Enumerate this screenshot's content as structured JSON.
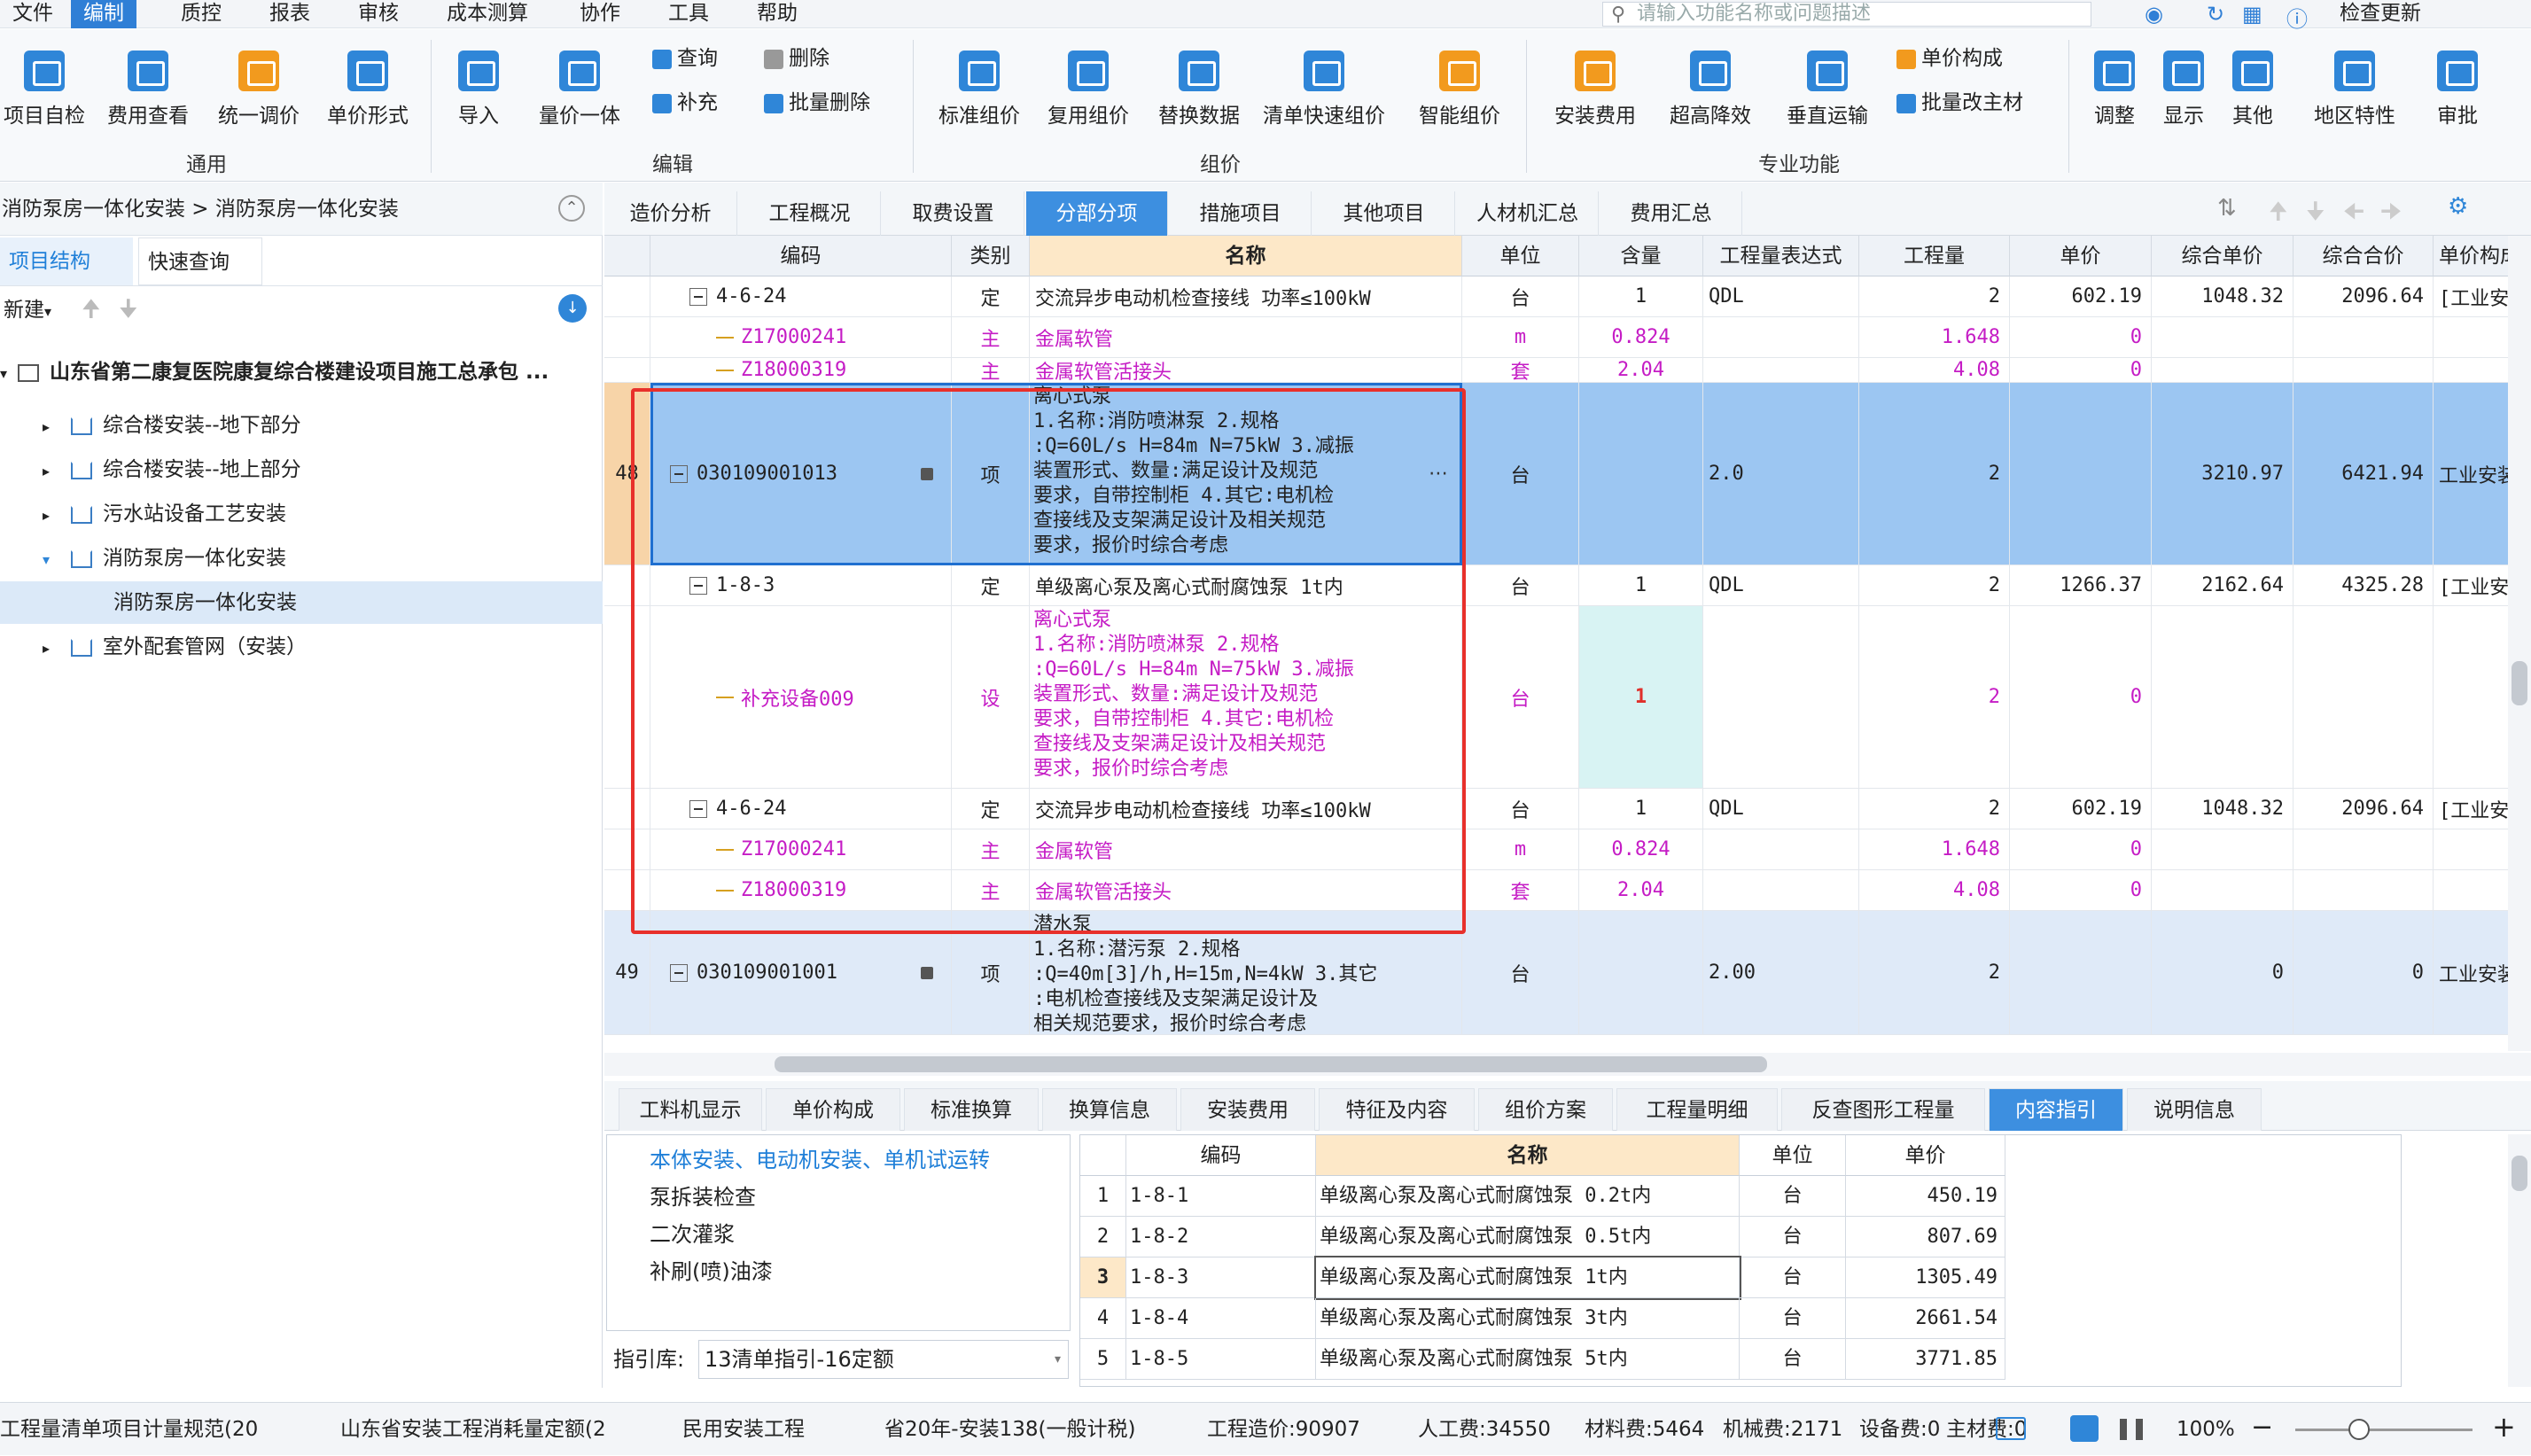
{
  "menubar": {
    "items": [
      "文件",
      "编制",
      "质控",
      "报表",
      "审核",
      "成本测算",
      "协作",
      "工具",
      "帮助"
    ],
    "search_placeholder": "请输入功能名称或问题描述",
    "check_update": "检查更新"
  },
  "ribbon": {
    "general": {
      "label": "通用",
      "buttons": [
        "项目自检",
        "费用查看",
        "统一调价",
        "单价形式"
      ]
    },
    "edit": {
      "label": "编辑",
      "buttons": [
        "导入",
        "量价一体"
      ],
      "small": [
        "查询",
        "删除",
        "补充",
        "批量删除"
      ]
    },
    "group": {
      "label": "组价",
      "buttons": [
        "标准组价",
        "复用组价",
        "替换数据",
        "清单快速组价",
        "智能组价"
      ]
    },
    "special": {
      "label": "专业功能",
      "buttons": [
        "安装费用",
        "超高降效",
        "垂直运输"
      ],
      "small": [
        "单价构成",
        "批量改主材"
      ]
    },
    "right": {
      "buttons": [
        "调整",
        "显示",
        "其他",
        "地区特性",
        "审批"
      ]
    }
  },
  "left": {
    "breadcrumb": "消防泵房一体化安装 > 消防泵房一体化安装",
    "tabs": [
      "项目结构",
      "快速查询"
    ],
    "new_label": "新建",
    "root": "山东省第二康复医院康复综合楼建设项目施工总承包 ...",
    "nodes": [
      "综合楼安装--地下部分",
      "综合楼安装--地上部分",
      "污水站设备工艺安装",
      "消防泵房一体化安装",
      "消防泵房一体化安装",
      "室外配套管网（安装）"
    ]
  },
  "main_tabs": [
    "造价分析",
    "工程概况",
    "取费设置",
    "分部分项",
    "措施项目",
    "其他项目",
    "人材机汇总",
    "费用汇总"
  ],
  "grid": {
    "headers": [
      "编码",
      "类别",
      "名称",
      "单位",
      "含量",
      "工程量表达式",
      "工程量",
      "单价",
      "综合单价",
      "综合合价",
      "单价构成"
    ],
    "rows": [
      {
        "no": "",
        "code": "4-6-24",
        "type": "定",
        "name": "交流异步电动机检查接线 功率≤100kW",
        "unit": "台",
        "qty_ratio": "1",
        "expr": "QDL",
        "qty": "2",
        "price": "602.19",
        "comp_price": "1048.32",
        "comp_total": "2096.64",
        "struct": "[工业安装"
      },
      {
        "no": "",
        "code": "Z17000241",
        "type": "主",
        "name": "金属软管",
        "unit": "m",
        "qty_ratio": "0.824",
        "expr": "",
        "qty": "1.648",
        "price": "0",
        "comp_price": "",
        "comp_total": "",
        "struct": ""
      },
      {
        "no": "",
        "code": "Z18000319",
        "type": "主",
        "name": "金属软管活接头",
        "unit": "套",
        "qty_ratio": "2.04",
        "expr": "",
        "qty": "4.08",
        "price": "0",
        "comp_price": "",
        "comp_total": "",
        "struct": ""
      },
      {
        "no": "48",
        "code": "030109001013",
        "type": "项",
        "name": "离心式泵\n1.名称:消防喷淋泵 2.规格\n:Q=60L/s  H=84m  N=75kW  3.减振\n装置形式、数量:满足设计及规范\n要求，自带控制柜 4.其它:电机检\n查接线及支架满足设计及相关规范\n要求，报价时综合考虑",
        "unit": "台",
        "qty_ratio": "",
        "expr": "2.0",
        "qty": "2",
        "price": "",
        "comp_price": "3210.97",
        "comp_total": "6421.94",
        "struct": "工业安装工"
      },
      {
        "no": "",
        "code": "1-8-3",
        "type": "定",
        "name": "单级离心泵及离心式耐腐蚀泵 1t内",
        "unit": "台",
        "qty_ratio": "1",
        "expr": "QDL",
        "qty": "2",
        "price": "1266.37",
        "comp_price": "2162.64",
        "comp_total": "4325.28",
        "struct": "[工业安装"
      },
      {
        "no": "",
        "code": "补充设备009",
        "type": "设",
        "name": "离心式泵\n1.名称:消防喷淋泵 2.规格\n:Q=60L/s  H=84m  N=75kW  3.减振\n装置形式、数量:满足设计及规范\n要求，自带控制柜 4.其它:电机检\n查接线及支架满足设计及相关规范\n要求，报价时综合考虑",
        "unit": "台",
        "qty_ratio": "1",
        "expr": "",
        "qty": "2",
        "price": "0",
        "comp_price": "",
        "comp_total": "",
        "struct": ""
      },
      {
        "no": "",
        "code": "4-6-24",
        "type": "定",
        "name": "交流异步电动机检查接线 功率≤100kW",
        "unit": "台",
        "qty_ratio": "1",
        "expr": "QDL",
        "qty": "2",
        "price": "602.19",
        "comp_price": "1048.32",
        "comp_total": "2096.64",
        "struct": "[工业安装"
      },
      {
        "no": "",
        "code": "Z17000241",
        "type": "主",
        "name": "金属软管",
        "unit": "m",
        "qty_ratio": "0.824",
        "expr": "",
        "qty": "1.648",
        "price": "0",
        "comp_price": "",
        "comp_total": "",
        "struct": ""
      },
      {
        "no": "",
        "code": "Z18000319",
        "type": "主",
        "name": "金属软管活接头",
        "unit": "套",
        "qty_ratio": "2.04",
        "expr": "",
        "qty": "4.08",
        "price": "0",
        "comp_price": "",
        "comp_total": "",
        "struct": ""
      },
      {
        "no": "49",
        "code": "030109001001",
        "type": "项",
        "name": "潜水泵\n1.名称:潜污泵 2.规格\n:Q=40m[3]/h,H=15m,N=4kW  3.其它\n:电机检查接线及支架满足设计及\n相关规范要求，报价时综合考虑",
        "unit": "台",
        "qty_ratio": "",
        "expr": "2.00",
        "qty": "2",
        "price": "",
        "comp_price": "0",
        "comp_total": "0",
        "struct": "工业安装工"
      }
    ]
  },
  "bottom_tabs": [
    "工料机显示",
    "单价构成",
    "标准换算",
    "换算信息",
    "安装费用",
    "特征及内容",
    "组价方案",
    "工程量明细",
    "反查图形工程量",
    "内容指引",
    "说明信息"
  ],
  "guide": {
    "items": [
      "本体安装、电动机安装、单机试运转",
      "泵拆装检查",
      "二次灌浆",
      "补刷(喷)油漆"
    ],
    "lib_label": "指引库:",
    "lib_value": "13清单指引-16定额"
  },
  "sub": {
    "headers": [
      "编码",
      "名称",
      "单位",
      "单价"
    ],
    "rows": [
      {
        "no": "1",
        "code": "1-8-1",
        "name": "单级离心泵及离心式耐腐蚀泵 0.2t内",
        "unit": "台",
        "price": "450.19"
      },
      {
        "no": "2",
        "code": "1-8-2",
        "name": "单级离心泵及离心式耐腐蚀泵 0.5t内",
        "unit": "台",
        "price": "807.69"
      },
      {
        "no": "3",
        "code": "1-8-3",
        "name": "单级离心泵及离心式耐腐蚀泵 1t内",
        "unit": "台",
        "price": "1305.49"
      },
      {
        "no": "4",
        "code": "1-8-4",
        "name": "单级离心泵及离心式耐腐蚀泵 3t内",
        "unit": "台",
        "price": "2661.54"
      },
      {
        "no": "5",
        "code": "1-8-5",
        "name": "单级离心泵及离心式耐腐蚀泵 5t内",
        "unit": "台",
        "price": "3771.85"
      }
    ]
  },
  "status": {
    "spec": "工程量清单项目计量规范(20",
    "quota": "山东省安装工程消耗量定额(2",
    "type": "民用安装工程",
    "rate": "省20年-安装138(一般计税)",
    "total": "工程造价:90907",
    "labor": "人工费:34550",
    "material": "材料费:5464",
    "machine": "机械费:2171",
    "equip": "设备费:0",
    "main_mat": "主材费:0",
    "zoom": "100%"
  },
  "colors": {
    "accent": "#2f7fd6",
    "selected_row": "#9cc6f2",
    "highlight_frame": "#e8302b",
    "magenta": "#c51cc5"
  }
}
